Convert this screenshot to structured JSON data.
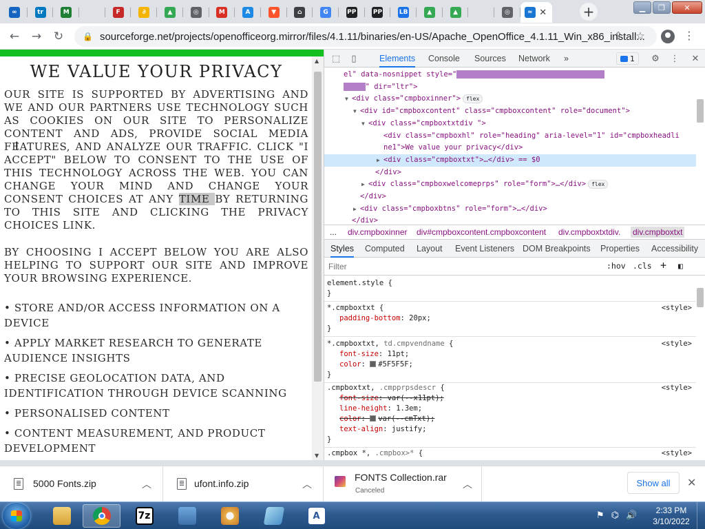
{
  "browser": {
    "tabs": [
      {
        "icon": "edge-circle-icon",
        "color": "#1565c0",
        "glyph": "∞",
        "active": false
      },
      {
        "icon": "trello-icon",
        "color": "#0079bf",
        "glyph": "tr",
        "active": false
      },
      {
        "icon": "m-green-icon",
        "color": "#1e7e34",
        "glyph": "M",
        "active": false
      },
      {
        "icon": "blank-icon",
        "color": "",
        "glyph": "",
        "active": false
      },
      {
        "icon": "f-red-icon",
        "color": "#c62828",
        "glyph": "F",
        "active": false
      },
      {
        "icon": "drive-multicolor-icon",
        "color": "#f4b400",
        "glyph": "∂",
        "active": false
      },
      {
        "icon": "google-drive-icon",
        "color": "#34a853",
        "glyph": "▲",
        "active": false
      },
      {
        "icon": "globe-icon",
        "color": "#5f6368",
        "glyph": "◎",
        "active": false
      },
      {
        "icon": "gmail-icon",
        "color": "#d93025",
        "glyph": "M",
        "active": false
      },
      {
        "icon": "app-store-icon",
        "color": "#1e88e5",
        "glyph": "A",
        "active": false
      },
      {
        "icon": "brave-icon",
        "color": "#fb542b",
        "glyph": "▼",
        "active": false
      },
      {
        "icon": "museum-icon",
        "color": "#3c4043",
        "glyph": "⌂",
        "active": false
      },
      {
        "icon": "google-icon",
        "color": "#4285f4",
        "glyph": "G",
        "active": false
      },
      {
        "icon": "pp-icon",
        "color": "#202124",
        "glyph": "PP",
        "active": false
      },
      {
        "icon": "pp-icon",
        "color": "#202124",
        "glyph": "PP",
        "active": false
      },
      {
        "icon": "lb-icon",
        "color": "#1a73e8",
        "glyph": "LB",
        "active": false
      },
      {
        "icon": "google-drive-icon",
        "color": "#34a853",
        "glyph": "▲",
        "active": false
      },
      {
        "icon": "google-drive-icon",
        "color": "#34a853",
        "glyph": "▲",
        "active": false
      },
      {
        "icon": "blank-icon",
        "color": "",
        "glyph": "",
        "active": false
      },
      {
        "icon": "globe-icon",
        "color": "#5f6368",
        "glyph": "◎",
        "active": false
      },
      {
        "icon": "sourceforge-icon",
        "color": "#1976d2",
        "glyph": "≈",
        "active": true
      }
    ],
    "active_tab_close": "✕",
    "new_tab": "+",
    "url_host": "sourceforge.net",
    "url_path": "/projects/openofficeorg.mirror/files/4.1.11/binaries/en-US/Apache_OpenOffice_4.1.11_Win_x86_install..."
  },
  "page": {
    "heading": "We value your privacy",
    "para1_before": "Our site is supported by advertising and we and our partners use technology such as cookies on our site to personalize content and ads, provide social media features, and analyze our traffic. Click \"I Accept\" below to consent to the use of this technology across the web. You can change your mind and change your consent choices at any ",
    "para1_highlight": "time ",
    "para1_after": "by returning to this site and clicking the Privacy Choices link.",
    "para2": "By choosing I Accept below you are also helping to support our site and improve your browsing experience.",
    "purposes": [
      "• Store and/or access information on a device",
      "• Apply market research to generate audience insights",
      "• Precise geolocation data, and identification through device scanning",
      "• Personalised content",
      "• Content measurement, and product development"
    ],
    "accent": "#13bf1e"
  },
  "devtools": {
    "tabs": [
      "Elements",
      "Console",
      "Sources",
      "Network"
    ],
    "more_tabs": "»",
    "issues_count": "1",
    "elements": [
      {
        "text": "el\" data-nosnippet style=\"",
        "tail_attr": "",
        "kind": "raw1"
      },
      {
        "kind": "raw2",
        "text": "\" dir=\"ltr\">"
      },
      {
        "kind": "node",
        "text": "<div class=\"cmpboxinner\">",
        "badge": "flex"
      },
      {
        "kind": "node",
        "text": "<div id=\"cmpboxcontent\" class=\"cmpboxcontent\" role=\"document\">"
      },
      {
        "kind": "node",
        "text": "<div class=\"cmpboxtxtdiv \">"
      },
      {
        "kind": "node",
        "text": "<div class=\"cmpboxhl\" role=\"heading\" aria-level=\"1\" id=\"cmpboxheadli"
      },
      {
        "kind": "node",
        "text": "ne1\">We value your privacy</div>"
      },
      {
        "kind": "node",
        "text": "<div class=\"cmpboxtxt\">…</div> == $0"
      },
      {
        "kind": "node",
        "text": "</div>"
      },
      {
        "kind": "node",
        "text": "<div class=\"cmpboxwelcomeprps\" role=\"form\">…</div>",
        "badge": "flex"
      },
      {
        "kind": "node",
        "text": "</div>"
      },
      {
        "kind": "node",
        "text": "<div class=\"cmpboxbtns\" role=\"form\">…</div>"
      },
      {
        "kind": "node",
        "text": "</div>"
      }
    ],
    "breadcrumbs": [
      "...",
      "div.cmpboxinner",
      "div#cmpboxcontent.cmpboxcontent",
      "div.cmpboxtxtdiv.",
      "div.cmpboxtxt"
    ],
    "subtabs": [
      "Styles",
      "Computed",
      "Layout",
      "Event Listeners",
      "DOM Breakpoints",
      "Properties",
      "Accessibility"
    ],
    "filter_placeholder": "Filter",
    "hov": ":hov",
    "cls": ".cls",
    "plus": "+",
    "rules": [
      {
        "selector": "element.style {",
        "source": "",
        "props": [],
        "close": "}"
      },
      {
        "selector": "*.cmpboxtxt {",
        "source": "<style>",
        "props": [
          {
            "name": "padding-bottom",
            "value": "20px;"
          }
        ],
        "close": "}"
      },
      {
        "selector": "*.cmpboxtxt, ",
        "selector_dim": "td.cmpvendname",
        "selector_tail": " {",
        "source": "<style>",
        "props": [
          {
            "name": "font-size",
            "value": "11pt;"
          },
          {
            "name": "color",
            "value": "#5F5F5F;",
            "swatch": true
          }
        ],
        "close": "}"
      },
      {
        "selector": ".cmpboxtxt, ",
        "selector_dim": ".cmpprpsdescr",
        "selector_tail": " {",
        "source": "<style>",
        "props": [
          {
            "name": "font-size",
            "value": "var(--x11pt);",
            "strike": true
          },
          {
            "name": "line-height",
            "value": "1.3em;"
          },
          {
            "name": "color",
            "value": "var(--cmTxt);",
            "strike": true,
            "swatch": true
          },
          {
            "name": "text-align",
            "value": "justify;"
          }
        ],
        "close": "}"
      },
      {
        "selector": ".cmpbox *, ",
        "selector_dim": ".cmpbox>*",
        "selector_tail": " {",
        "source": "<style>",
        "props": [
          {
            "name": "font-family",
            "value": "Arial,sans-serif;"
          }
        ],
        "close": ""
      }
    ]
  },
  "downloads": {
    "items": [
      {
        "name": "5000 Fonts.zip",
        "status": ""
      },
      {
        "name": "ufont.info.zip",
        "status": ""
      },
      {
        "name": "FONTS Collection.rar",
        "status": "Canceled"
      }
    ],
    "show_all": "Show all",
    "close": "✕"
  },
  "taskbar": {
    "apps": [
      "explorer-icon",
      "chrome-icon",
      "7zip-icon",
      "control-panel-icon",
      "paint-icon",
      "notepad-icon",
      "word-icon"
    ],
    "seven_zip_label": "7z",
    "time": "2:33 PM",
    "date": "3/10/2022"
  }
}
